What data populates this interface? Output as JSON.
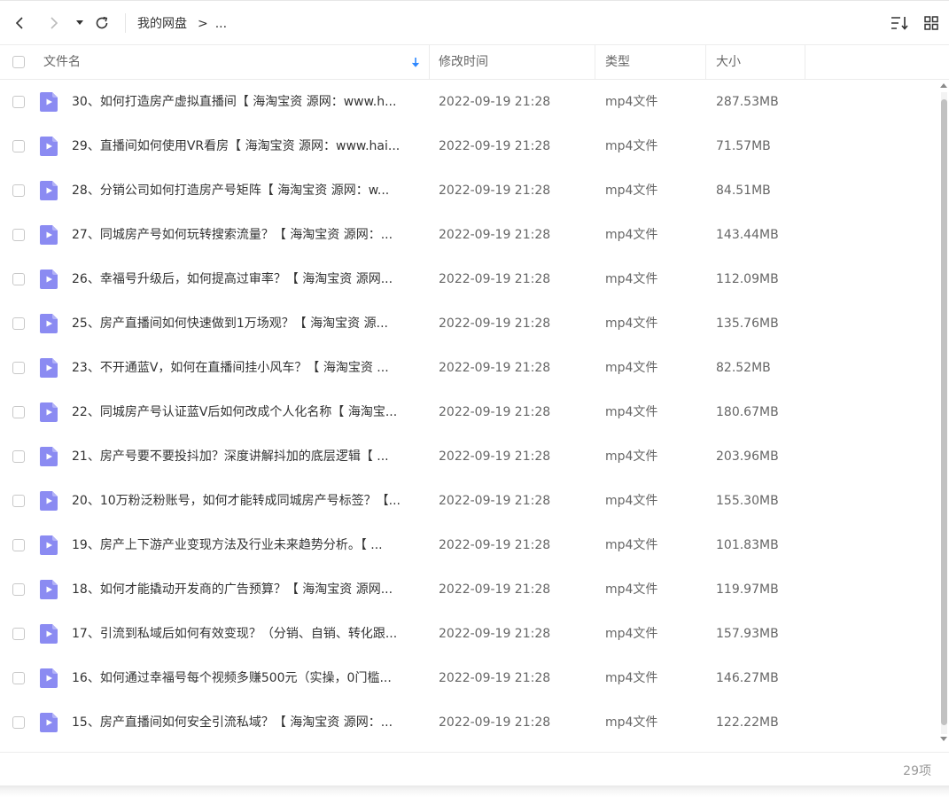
{
  "toolbar": {
    "back_icon": "chevron-left-icon",
    "forward_icon": "chevron-right-icon",
    "history_dropdown_icon": "caret-down-icon",
    "refresh_icon": "refresh-icon",
    "sort_icon": "sort-icon",
    "grid_view_icon": "grid-icon"
  },
  "breadcrumb": {
    "root": "我的网盘",
    "separator": ">",
    "more": "..."
  },
  "columns": {
    "name": "文件名",
    "modified": "修改时间",
    "type": "类型",
    "size": "大小"
  },
  "files": [
    {
      "name": "30、如何打造房产虚拟直播间【 海淘宝资 源网：www.h...",
      "modified": "2022-09-19 21:28",
      "type": "mp4文件",
      "size": "287.53MB"
    },
    {
      "name": "29、直播间如何使用VR看房【 海淘宝资 源网：www.hai...",
      "modified": "2022-09-19 21:28",
      "type": "mp4文件",
      "size": "71.57MB"
    },
    {
      "name": "28、分销公司如何打造房产号矩阵【 海淘宝资 源网：w...",
      "modified": "2022-09-19 21:28",
      "type": "mp4文件",
      "size": "84.51MB"
    },
    {
      "name": "27、同城房产号如何玩转搜索流量？【 海淘宝资 源网：...",
      "modified": "2022-09-19 21:28",
      "type": "mp4文件",
      "size": "143.44MB"
    },
    {
      "name": "26、幸福号升级后，如何提高过审率？【 海淘宝资 源网...",
      "modified": "2022-09-19 21:28",
      "type": "mp4文件",
      "size": "112.09MB"
    },
    {
      "name": "25、房产直播间如何快速做到1万场观？【 海淘宝资 源...",
      "modified": "2022-09-19 21:28",
      "type": "mp4文件",
      "size": "135.76MB"
    },
    {
      "name": "23、不开通蓝V，如何在直播间挂小风车？【 海淘宝资 ...",
      "modified": "2022-09-19 21:28",
      "type": "mp4文件",
      "size": "82.52MB"
    },
    {
      "name": "22、同城房产号认证蓝V后如何改成个人化名称【 海淘宝...",
      "modified": "2022-09-19 21:28",
      "type": "mp4文件",
      "size": "180.67MB"
    },
    {
      "name": "21、房产号要不要投抖加？深度讲解抖加的底层逻辑【 ...",
      "modified": "2022-09-19 21:28",
      "type": "mp4文件",
      "size": "203.96MB"
    },
    {
      "name": "20、10万粉泛粉账号，如何才能转成同城房产号标签？【...",
      "modified": "2022-09-19 21:28",
      "type": "mp4文件",
      "size": "155.30MB"
    },
    {
      "name": "19、房产上下游产业变现方法及行业未来趋势分析。【 ...",
      "modified": "2022-09-19 21:28",
      "type": "mp4文件",
      "size": "101.83MB"
    },
    {
      "name": "18、如何才能撬动开发商的广告预算？【 海淘宝资 源网...",
      "modified": "2022-09-19 21:28",
      "type": "mp4文件",
      "size": "119.97MB"
    },
    {
      "name": "17、引流到私域后如何有效变现？（分销、自销、转化跟...",
      "modified": "2022-09-19 21:28",
      "type": "mp4文件",
      "size": "157.93MB"
    },
    {
      "name": "16、如何通过幸福号每个视频多赚500元（实操，0门槛...",
      "modified": "2022-09-19 21:28",
      "type": "mp4文件",
      "size": "146.27MB"
    },
    {
      "name": "15、房产直播间如何安全引流私域？【 海淘宝资 源网：...",
      "modified": "2022-09-19 21:28",
      "type": "mp4文件",
      "size": "122.22MB"
    }
  ],
  "footer": {
    "count": "29项"
  },
  "colors": {
    "video_icon": "#8b8bf2",
    "sort_arrow": "#2f88ff"
  }
}
